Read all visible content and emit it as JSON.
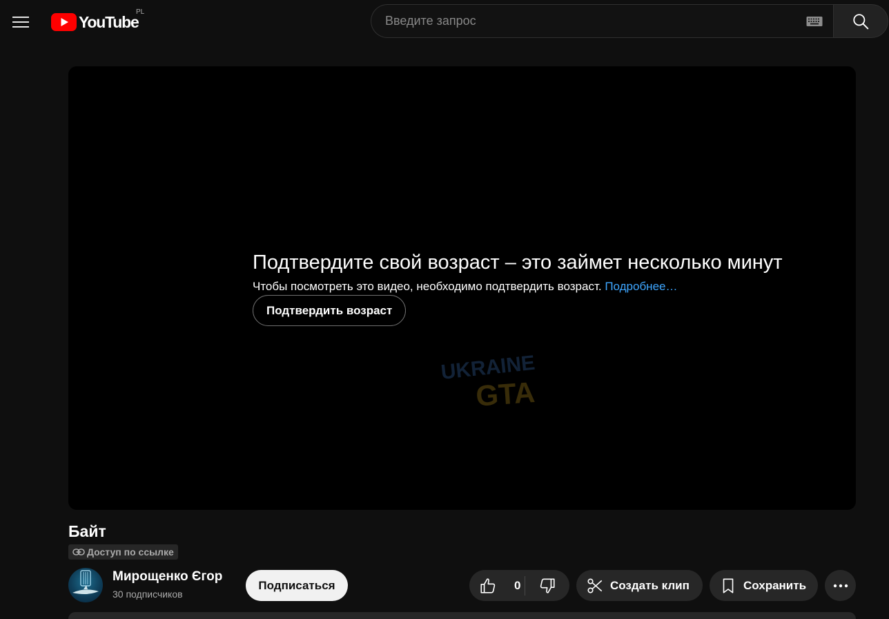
{
  "masthead": {
    "logo_text": "YouTube",
    "country_code": "PL",
    "search_placeholder": "Введите запрос"
  },
  "player": {
    "age_gate_title": "Подтвердите свой возраст – это займет несколько минут",
    "age_gate_description": "Чтобы посмотреть это видео, необходимо подтвердить возраст.",
    "age_gate_link": "Подробнее…",
    "age_gate_button": "Подтвердить возраст",
    "watermark_top": "UKRAINE",
    "watermark_bottom": "GTA"
  },
  "video": {
    "title": "Байт",
    "visibility_badge": "Доступ по ссылке"
  },
  "channel": {
    "name": "Мирощенко Єгор",
    "subscribers": "30 подписчиков",
    "subscribe_label": "Подписаться"
  },
  "actions": {
    "like_count": "0",
    "clip_label": "Создать клип",
    "save_label": "Сохранить"
  },
  "colors": {
    "background": "#0f0f0f",
    "brand_red": "#ff0000",
    "link_blue": "#3ea6ff",
    "pill_bg": "#272727"
  },
  "icons": [
    "menu-icon",
    "youtube-logo-icon",
    "keyboard-icon",
    "search-icon",
    "link-icon",
    "thumbs-up-icon",
    "thumbs-down-icon",
    "scissors-icon",
    "bookmark-icon",
    "more-icon"
  ]
}
